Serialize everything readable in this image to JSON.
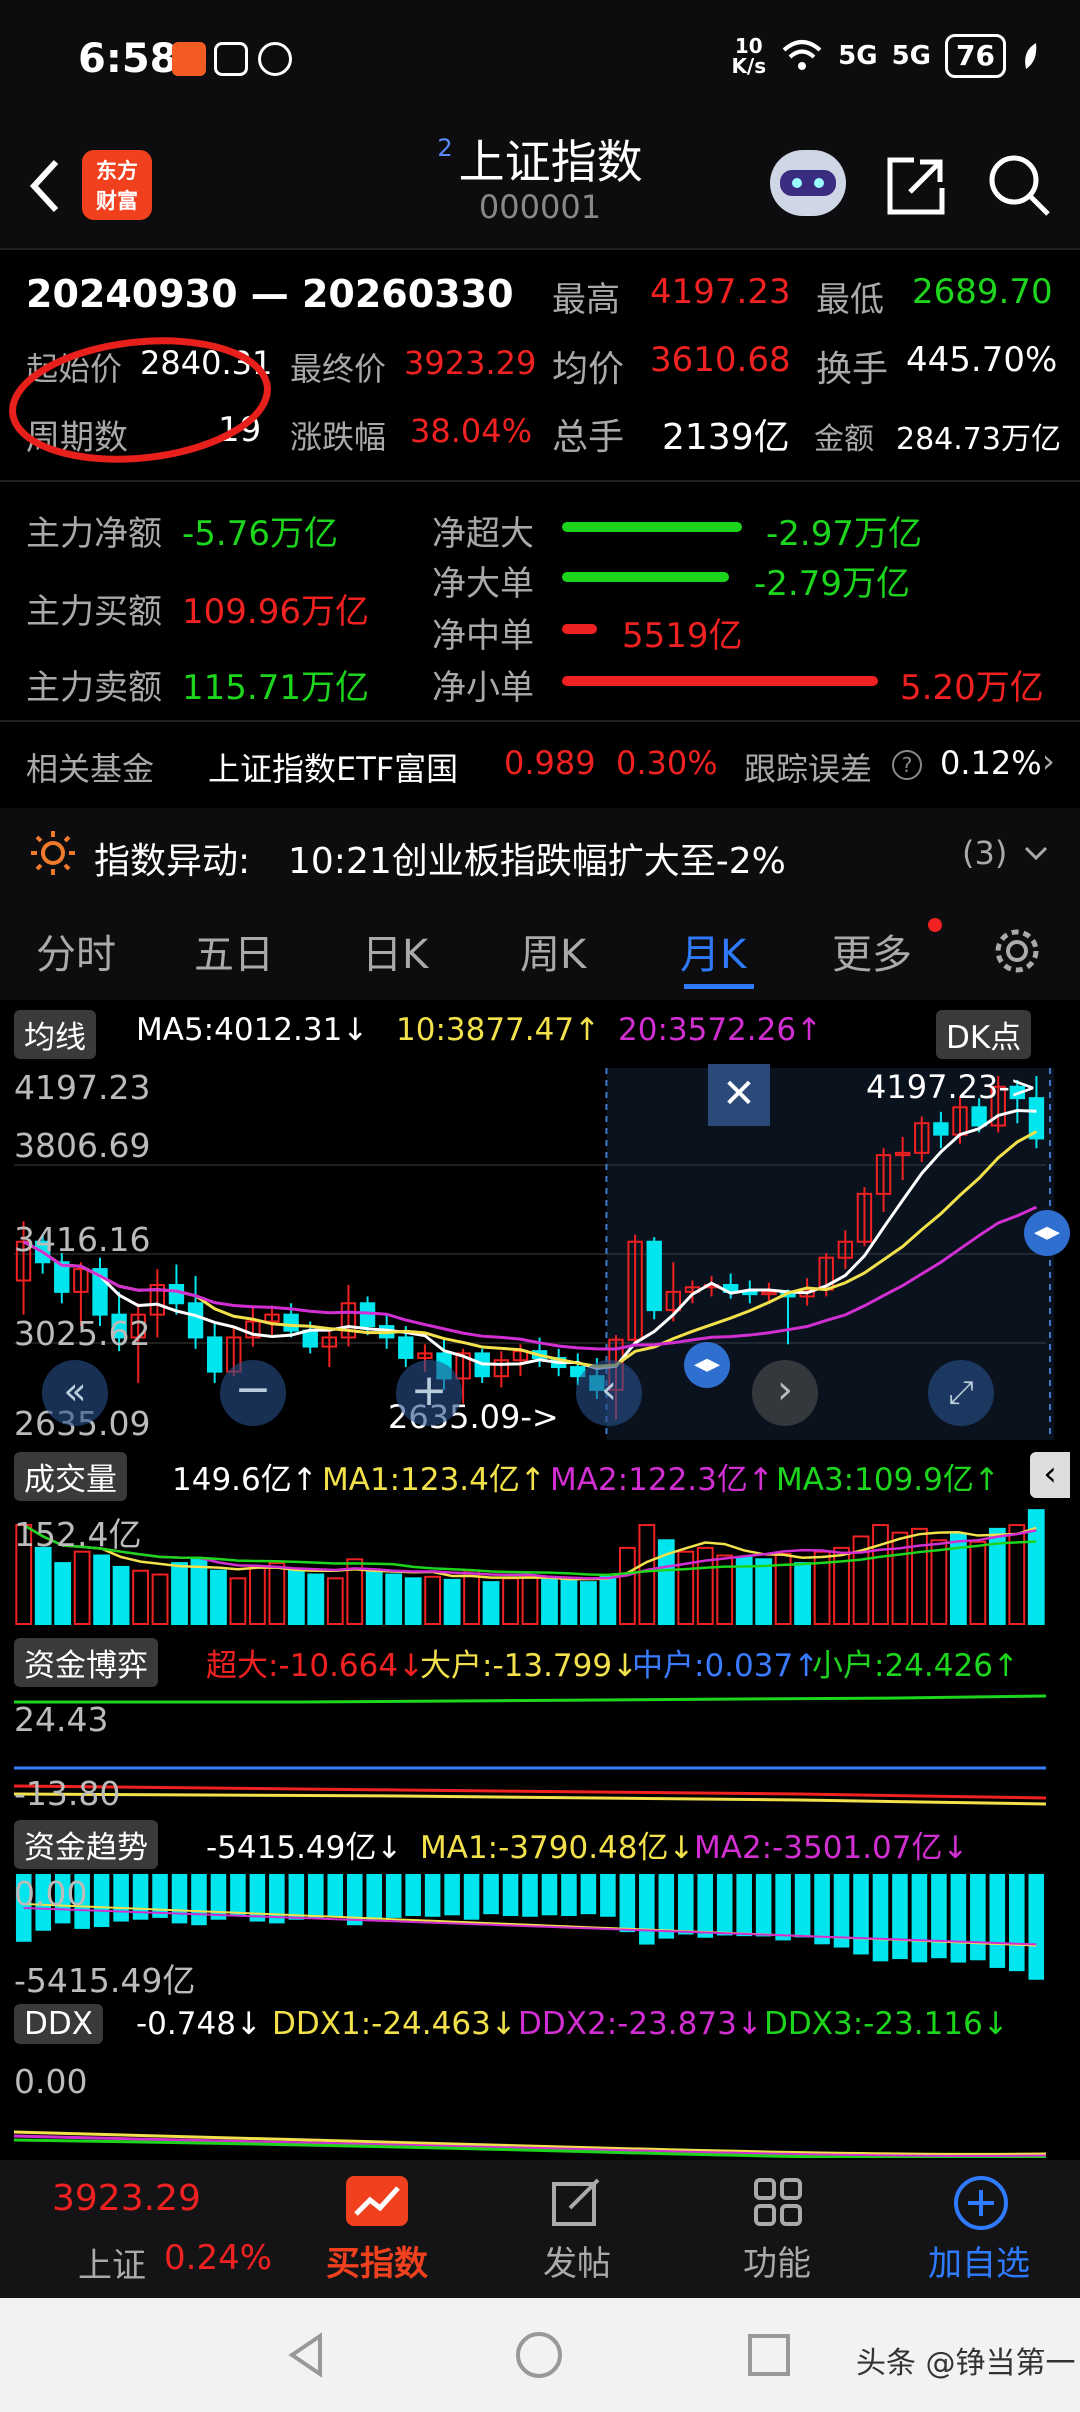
{
  "status": {
    "time": "6:58",
    "net_speed_top": "10",
    "net_speed_bottom": "K/s",
    "signal1": "5G",
    "signal2": "5G",
    "battery": "76"
  },
  "header": {
    "superscript": "2",
    "title": "上证指数",
    "code": "000001"
  },
  "summary": {
    "date_range": "20240930 — 20260330",
    "high_label": "最高",
    "high": "4197.23",
    "low_label": "最低",
    "low": "2689.70",
    "start_label": "起始价",
    "start": "2840.31",
    "final_label": "最终价",
    "final": "3923.29",
    "avg_label": "均价",
    "avg": "3610.68",
    "turnover_label": "换手",
    "turnover": "445.70%",
    "periods_label": "周期数",
    "periods": "19",
    "change_label": "涨跌幅",
    "change": "38.04%",
    "volume_label": "总手",
    "volume": "2139亿",
    "amount_label": "金额",
    "amount": "284.73万亿"
  },
  "flows": {
    "main_net_label": "主力净额",
    "main_net": "-5.76万亿",
    "main_buy_label": "主力买额",
    "main_buy": "109.96万亿",
    "main_sell_label": "主力卖额",
    "main_sell": "115.71万亿",
    "super_label": "净超大",
    "super": "-2.97万亿",
    "super_pct": 0.57,
    "large_label": "净大单",
    "large": "-2.79万亿",
    "large_pct": 0.53,
    "medium_label": "净中单",
    "medium": "5519亿",
    "medium_pct": 0.11,
    "small_label": "净小单",
    "small": "5.20万亿",
    "small_pct": 1.0
  },
  "fund": {
    "label": "相关基金",
    "name": "上证指数ETF富国",
    "price": "0.989",
    "change": "0.30%",
    "err_label": "跟踪误差",
    "err": "0.12%"
  },
  "alert": {
    "label": "指数异动:",
    "text": "10:21创业板指跌幅扩大至-2%",
    "count": "(3)"
  },
  "tabs": [
    "分时",
    "五日",
    "日K",
    "周K",
    "月K",
    "更多"
  ],
  "active_tab": "月K",
  "ma_legend": {
    "label": "均线",
    "ma5": "MA5:4012.31↓",
    "ma10": "10:3877.47↑",
    "ma20": "20:3572.26↑",
    "dk": "DK点"
  },
  "price_axis": [
    "4197.23",
    "3806.69",
    "3416.16",
    "3025.62",
    "2635.09"
  ],
  "price_marks": {
    "high": "4197.23->",
    "low": "2635.09->"
  },
  "vol_legend": {
    "label": "成交量",
    "val": "149.6亿↑",
    "ma1": "MA1:123.4亿↑",
    "ma2": "MA2:122.3亿↑",
    "ma3": "MA3:109.9亿↑",
    "axis": "152.4亿"
  },
  "game_legend": {
    "label": "资金博弈",
    "super": "超大:-10.664↓",
    "large": "大户:-13.799↓",
    "mid": "中户:0.037↑",
    "small": "小户:24.426↑",
    "axis_top": "24.43",
    "axis_bottom": "-13.80"
  },
  "trend_legend": {
    "label": "资金趋势",
    "val": "-5415.49亿↓",
    "ma1": "MA1:-3790.48亿↓",
    "ma2": "MA2:-3501.07亿↓",
    "axis_top": "0.00",
    "axis_bottom": "-5415.49亿"
  },
  "ddx_legend": {
    "label": "DDX",
    "val": "-0.748↓",
    "ddx1": "DDX1:-24.463↓",
    "ddx2": "DDX2:-23.873↓",
    "ddx3": "DDX3:-23.116↓",
    "axis": "0.00"
  },
  "bottom_nav": {
    "price": "3923.29",
    "name": "上证",
    "pct": "0.24%",
    "buy": "买指数",
    "post": "发帖",
    "func": "功能",
    "add": "加自选"
  },
  "watermark": "头条 @铮当第一",
  "colors": {
    "up": "#f02121",
    "down": "#00e5ee",
    "ma5": "#ffffff",
    "ma10": "#f2e14b",
    "ma20": "#d12fd1",
    "accent": "#2f7bff"
  },
  "chart_data": {
    "type": "candlestick",
    "ylim": [
      2635.09,
      4197.23
    ],
    "candles": [
      {
        "o": 3300,
        "h": 3560,
        "l": 3150,
        "c": 3470
      },
      {
        "o": 3470,
        "h": 3500,
        "l": 3330,
        "c": 3380
      },
      {
        "o": 3380,
        "h": 3420,
        "l": 3200,
        "c": 3250
      },
      {
        "o": 3250,
        "h": 3380,
        "l": 3100,
        "c": 3350
      },
      {
        "o": 3350,
        "h": 3400,
        "l": 3100,
        "c": 3150
      },
      {
        "o": 3150,
        "h": 3250,
        "l": 2990,
        "c": 3050
      },
      {
        "o": 3050,
        "h": 3200,
        "l": 2850,
        "c": 3150
      },
      {
        "o": 3150,
        "h": 3350,
        "l": 3050,
        "c": 3280
      },
      {
        "o": 3280,
        "h": 3370,
        "l": 3150,
        "c": 3200
      },
      {
        "o": 3200,
        "h": 3320,
        "l": 3000,
        "c": 3050
      },
      {
        "o": 3050,
        "h": 3120,
        "l": 2850,
        "c": 2900
      },
      {
        "o": 2900,
        "h": 3100,
        "l": 2880,
        "c": 3050
      },
      {
        "o": 3050,
        "h": 3180,
        "l": 3010,
        "c": 3120
      },
      {
        "o": 3120,
        "h": 3190,
        "l": 3060,
        "c": 3150
      },
      {
        "o": 3150,
        "h": 3200,
        "l": 3050,
        "c": 3080
      },
      {
        "o": 3080,
        "h": 3120,
        "l": 2980,
        "c": 3010
      },
      {
        "o": 3010,
        "h": 3090,
        "l": 2920,
        "c": 3050
      },
      {
        "o": 3050,
        "h": 3280,
        "l": 3010,
        "c": 3200
      },
      {
        "o": 3200,
        "h": 3230,
        "l": 3060,
        "c": 3100
      },
      {
        "o": 3100,
        "h": 3150,
        "l": 3000,
        "c": 3050
      },
      {
        "o": 3050,
        "h": 3100,
        "l": 2920,
        "c": 2960
      },
      {
        "o": 2960,
        "h": 3020,
        "l": 2900,
        "c": 2980
      },
      {
        "o": 2980,
        "h": 3040,
        "l": 2820,
        "c": 2870
      },
      {
        "o": 2870,
        "h": 3000,
        "l": 2760,
        "c": 2980
      },
      {
        "o": 2980,
        "h": 3000,
        "l": 2850,
        "c": 2880
      },
      {
        "o": 2880,
        "h": 2990,
        "l": 2830,
        "c": 2950
      },
      {
        "o": 2950,
        "h": 3020,
        "l": 2880,
        "c": 2990
      },
      {
        "o": 2990,
        "h": 3050,
        "l": 2920,
        "c": 2960
      },
      {
        "o": 2960,
        "h": 3000,
        "l": 2880,
        "c": 2920
      },
      {
        "o": 2920,
        "h": 2980,
        "l": 2840,
        "c": 2880
      },
      {
        "o": 2880,
        "h": 2960,
        "l": 2780,
        "c": 2820
      },
      {
        "o": 2820,
        "h": 3060,
        "l": 2690,
        "c": 3040
      },
      {
        "o": 3040,
        "h": 3500,
        "l": 3010,
        "c": 3470
      },
      {
        "o": 3470,
        "h": 3490,
        "l": 3130,
        "c": 3170
      },
      {
        "o": 3170,
        "h": 3380,
        "l": 3120,
        "c": 3250
      },
      {
        "o": 3250,
        "h": 3300,
        "l": 3200,
        "c": 3270
      },
      {
        "o": 3270,
        "h": 3320,
        "l": 3230,
        "c": 3280
      },
      {
        "o": 3280,
        "h": 3330,
        "l": 3220,
        "c": 3250
      },
      {
        "o": 3250,
        "h": 3300,
        "l": 3200,
        "c": 3240
      },
      {
        "o": 3240,
        "h": 3290,
        "l": 3200,
        "c": 3250
      },
      {
        "o": 3250,
        "h": 3260,
        "l": 3020,
        "c": 3230
      },
      {
        "o": 3230,
        "h": 3310,
        "l": 3190,
        "c": 3260
      },
      {
        "o": 3260,
        "h": 3420,
        "l": 3230,
        "c": 3400
      },
      {
        "o": 3400,
        "h": 3520,
        "l": 3350,
        "c": 3470
      },
      {
        "o": 3470,
        "h": 3710,
        "l": 3450,
        "c": 3680
      },
      {
        "o": 3680,
        "h": 3880,
        "l": 3600,
        "c": 3850
      },
      {
        "o": 3850,
        "h": 3930,
        "l": 3740,
        "c": 3860
      },
      {
        "o": 3860,
        "h": 4020,
        "l": 3820,
        "c": 3990
      },
      {
        "o": 3990,
        "h": 4040,
        "l": 3880,
        "c": 3940
      },
      {
        "o": 3940,
        "h": 4110,
        "l": 3900,
        "c": 4060
      },
      {
        "o": 4060,
        "h": 4100,
        "l": 3950,
        "c": 3980
      },
      {
        "o": 3980,
        "h": 4197.23,
        "l": 3950,
        "c": 4150
      },
      {
        "o": 4150,
        "h": 4180,
        "l": 3990,
        "c": 4100
      },
      {
        "o": 4100,
        "h": 4197,
        "l": 3880,
        "c": 3923.29
      }
    ],
    "volume_ylim": [
      0,
      152.4
    ],
    "volumes": [
      130,
      100,
      80,
      95,
      90,
      75,
      70,
      65,
      80,
      85,
      70,
      60,
      75,
      80,
      70,
      65,
      60,
      85,
      70,
      65,
      60,
      62,
      58,
      70,
      55,
      60,
      62,
      58,
      60,
      55,
      62,
      100,
      130,
      110,
      95,
      100,
      90,
      88,
      85,
      92,
      80,
      95,
      100,
      115,
      130,
      120,
      125,
      110,
      118,
      108,
      125,
      130,
      149.6
    ]
  }
}
